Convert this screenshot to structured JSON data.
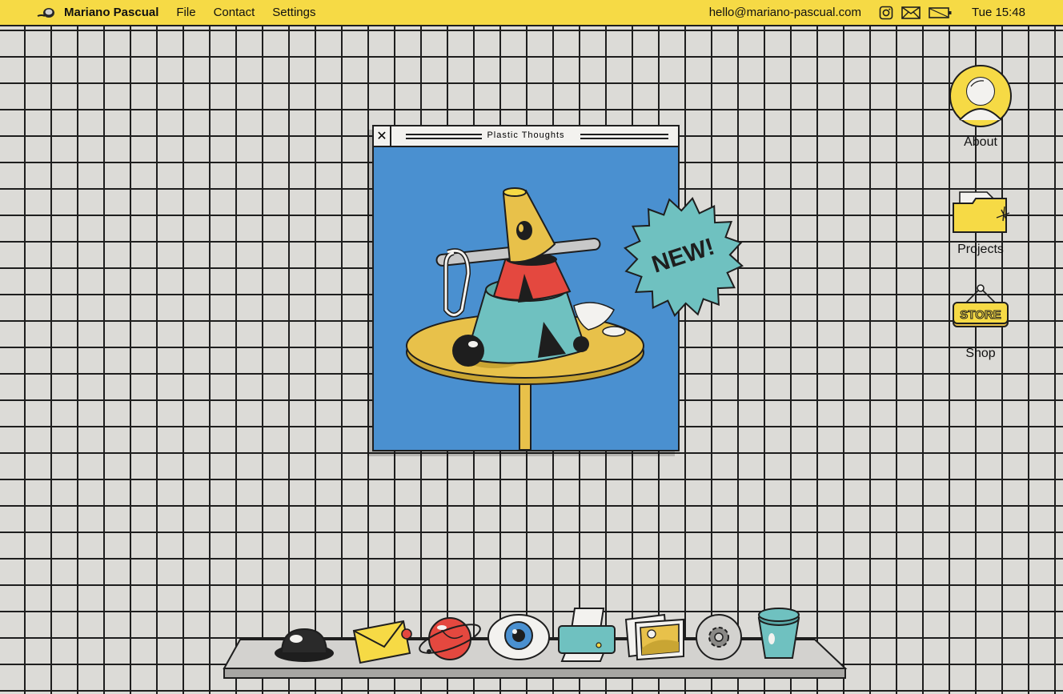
{
  "menubar": {
    "app_name": "Mariano Pascual",
    "menu": [
      "File",
      "Contact",
      "Settings"
    ],
    "email": "hello@mariano-pascual.com",
    "clock": "Tue 15:48",
    "icons": [
      "instagram-icon",
      "mail-icon",
      "battery-icon"
    ]
  },
  "window": {
    "title": "Plastic Thoughts",
    "close_glyph": "✕"
  },
  "badge": {
    "text": "NEW!",
    "color": "#6fc1c0"
  },
  "desktop_icons": [
    {
      "label": "About",
      "icon": "avatar-icon"
    },
    {
      "label": "Projects",
      "icon": "folder-icon"
    },
    {
      "label": "Shop",
      "icon": "store-sign-icon"
    }
  ],
  "dock": [
    "hole-icon",
    "envelope-icon",
    "planet-icon",
    "eye-icon",
    "printer-icon",
    "photos-icon",
    "settings-gear-icon",
    "trash-bin-icon"
  ],
  "colors": {
    "accent_yellow": "#f6da45",
    "window_blue": "#4a90d0",
    "teal": "#6fc1c0",
    "red": "#e4483f",
    "grid_bg": "#dcdbd7"
  }
}
